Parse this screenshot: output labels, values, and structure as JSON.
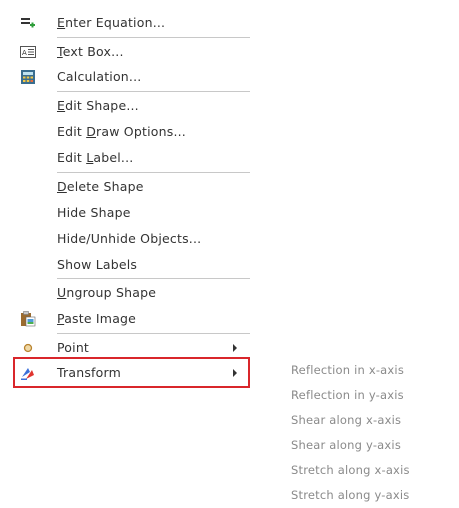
{
  "menu": {
    "items": [
      {
        "id": "enter-equation",
        "pre": "",
        "mnemonic": "E",
        "rest": "nter Equation...",
        "icon": "equation-add-icon"
      },
      {
        "id": "text-box",
        "pre": "",
        "mnemonic": "T",
        "rest": "ext Box...",
        "icon": "text-box-icon"
      },
      {
        "id": "calculation",
        "pre": "",
        "mnemonic": "",
        "rest": "Calculation...",
        "icon": "calculator-icon"
      },
      {
        "id": "edit-shape",
        "pre": "",
        "mnemonic": "E",
        "rest": "dit Shape...",
        "icon": ""
      },
      {
        "id": "edit-draw-options",
        "pre": "Edit ",
        "mnemonic": "D",
        "rest": "raw Options...",
        "icon": ""
      },
      {
        "id": "edit-label",
        "pre": "Edit ",
        "mnemonic": "L",
        "rest": "abel...",
        "icon": ""
      },
      {
        "id": "delete-shape",
        "pre": "",
        "mnemonic": "D",
        "rest": "elete Shape",
        "icon": ""
      },
      {
        "id": "hide-shape",
        "pre": "",
        "mnemonic": "",
        "rest": "Hide Shape",
        "icon": ""
      },
      {
        "id": "hide-unhide-objects",
        "pre": "",
        "mnemonic": "",
        "rest": "Hide/Unhide Objects...",
        "icon": ""
      },
      {
        "id": "show-labels",
        "pre": "",
        "mnemonic": "",
        "rest": "Show Labels",
        "icon": ""
      },
      {
        "id": "ungroup-shape",
        "pre": "",
        "mnemonic": "U",
        "rest": "ngroup Shape",
        "icon": ""
      },
      {
        "id": "paste-image",
        "pre": "",
        "mnemonic": "P",
        "rest": "aste Image",
        "icon": "clipboard-icon"
      },
      {
        "id": "point",
        "pre": "",
        "mnemonic": "",
        "rest": "Point",
        "icon": "point-icon",
        "submenu": true
      },
      {
        "id": "transform",
        "pre": "",
        "mnemonic": "",
        "rest": "Transform",
        "icon": "transform-icon",
        "submenu": true
      }
    ]
  },
  "transform_submenu": {
    "items": [
      "Reflection in x-axis",
      "Reflection in y-axis",
      "Shear along x-axis",
      "Shear along y-axis",
      "Stretch along x-axis",
      "Stretch along y-axis"
    ]
  },
  "colors": {
    "highlight_border": "#d9262b",
    "disabled_text": "#8a8a8a",
    "separator": "#c8c8c8",
    "text": "#333333"
  }
}
